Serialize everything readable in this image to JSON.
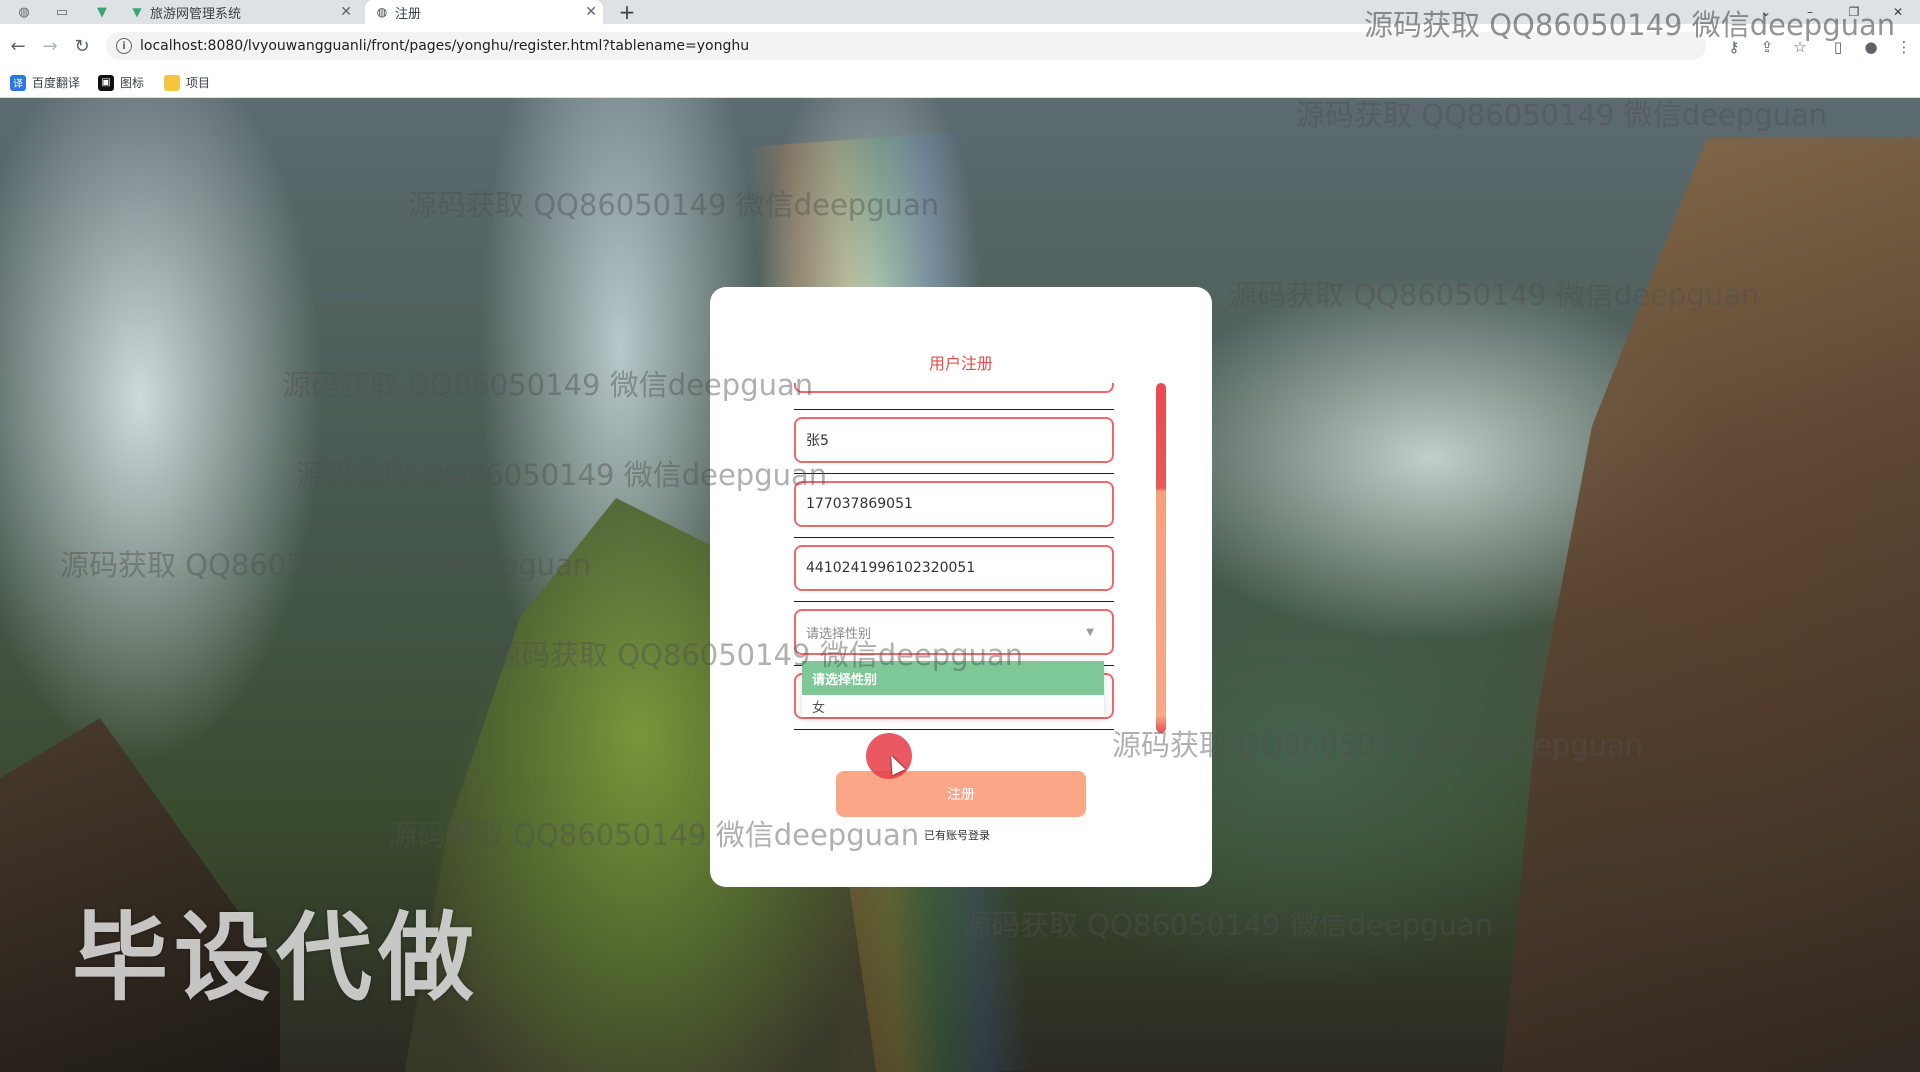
{
  "browser": {
    "tabs": [
      {
        "title": "旅游网管理系统",
        "active": false
      },
      {
        "title": "注册",
        "active": true
      }
    ],
    "url": "localhost:8080/lvyouwangguanli/front/pages/yonghu/register.html?tablename=yonghu",
    "bookmarks": [
      {
        "label": "百度翻译",
        "icon": "baidu-translate-icon",
        "color": "#2b78e4"
      },
      {
        "label": "图标",
        "icon": "image-icon",
        "color": "#111111"
      },
      {
        "label": "项目",
        "icon": "folder-icon",
        "color": "#f5c542"
      }
    ]
  },
  "card": {
    "title": "用户注册",
    "fields": [
      {
        "name": "name",
        "value": "张5"
      },
      {
        "name": "phone",
        "value": "177037869051"
      },
      {
        "name": "id-card",
        "value": "4410241996102320051"
      }
    ],
    "gender_select": {
      "placeholder": "请选择性别",
      "options": [
        "请选择性别",
        "女"
      ],
      "highlighted": "请选择性别"
    },
    "register_label": "注册",
    "login_link": "已有账号登录"
  },
  "watermark": {
    "text": "源码获取 QQ86050149 微信deepguan",
    "banner": "毕设代做"
  },
  "colors": {
    "accent": "#e2504f",
    "field_border": "#f0686d",
    "button": "#fba787",
    "dropdown_highlight": "#7dc896"
  }
}
